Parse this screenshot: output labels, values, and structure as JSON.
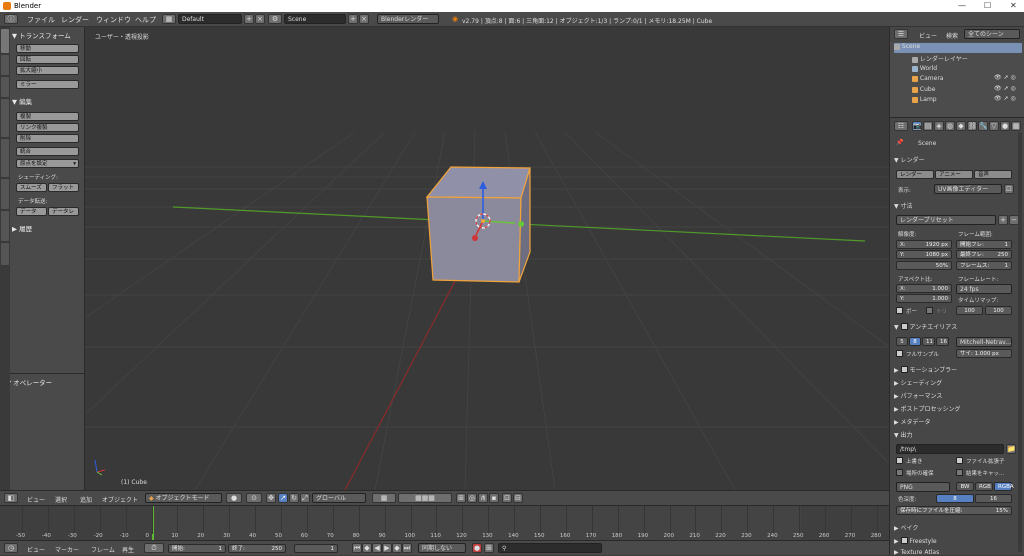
{
  "window": {
    "title": "Blender",
    "minimize": "—",
    "maximize": "☐",
    "close": "✕"
  },
  "menubar": {
    "menus": [
      "ファイル",
      "レンダー",
      "ウィンドウ",
      "ヘルプ"
    ],
    "layout": "Default",
    "scene": "Scene",
    "engine": "Blenderレンダー",
    "stats": "v2.79 | 頂点:8 | 面:6 | 三角面:12 | オブジェクト:1/3 | ランプ:0/1 | メモリ:18.25M | Cube"
  },
  "toolshelf": {
    "transform_header": "トランスフォーム",
    "transform_buttons": [
      "移動",
      "回転",
      "拡大縮小"
    ],
    "mirror": "ミラー",
    "edit_header": "編集",
    "edit_buttons": [
      "複製",
      "リンク複製",
      "削除"
    ],
    "join": "統合",
    "origin": "原点を設定",
    "shading_label": "シェーディング:",
    "smooth": "スムーズ",
    "flat": "フラット",
    "data_transfer_label": "データ転送:",
    "data": "データ",
    "data_layout": "データレ",
    "history": "履歴",
    "operator": "オペレーター"
  },
  "viewport": {
    "view_label": "ユーザー・透視投影",
    "object_label": "(1) Cube"
  },
  "viewport_header": {
    "view": "ビュー",
    "select": "選択",
    "add": "追加",
    "object": "オブジェクト",
    "mode": "オブジェクトモード",
    "orientation": "グローバル"
  },
  "timeline": {
    "ticks": [
      "-50",
      "-40",
      "-30",
      "-20",
      "-10",
      "0",
      "10",
      "20",
      "30",
      "40",
      "50",
      "60",
      "70",
      "80",
      "90",
      "100",
      "110",
      "120",
      "130",
      "140",
      "150",
      "160",
      "170",
      "180",
      "190",
      "200",
      "210",
      "220",
      "230",
      "240",
      "250",
      "260",
      "270",
      "280"
    ],
    "current_frame": 1
  },
  "timeline_header": {
    "view": "ビュー",
    "marker": "マーカー",
    "frame": "フレーム",
    "play": "再生",
    "start_label": "開始:",
    "start": "1",
    "end_label": "終了:",
    "end": "250",
    "current": "1",
    "sync": "同期しない"
  },
  "outliner": {
    "view": "ビュー",
    "search": "検索",
    "filter": "全てのシーン",
    "items": [
      "Scene",
      "レンダーレイヤー",
      "World",
      "Camera",
      "Cube",
      "Lamp"
    ]
  },
  "properties": {
    "scene": "Scene",
    "render_header": "レンダー",
    "render_btn": "レンダー",
    "anim_btn": "アニメー",
    "audio_btn": "音声",
    "display_label": "表示:",
    "display_value": "UV画像エディター",
    "dimensions_header": "寸法",
    "presets": "レンダープリセット",
    "resolution_label": "解像度:",
    "res_x": "X:",
    "res_x_val": "1920 px",
    "res_y": "Y:",
    "res_y_val": "1080 px",
    "res_pct": "50%",
    "frame_range_label": "フレーム範囲:",
    "frame_start": "開始フレ:",
    "frame_start_val": "1",
    "frame_end": "最終フレ:",
    "frame_end_val": "250",
    "frame_step": "フレームス:",
    "frame_step_val": "1",
    "aspect_label": "アスペクト比:",
    "asp_x": "X:",
    "asp_x_val": "1.000",
    "asp_y": "Y:",
    "asp_y_val": "1.000",
    "framerate_label": "フレームレート:",
    "fps": "24 fps",
    "time_remap": "タイムリマップ:",
    "remap_old": "100",
    "remap_new": "100",
    "border": "ボー",
    "crop": "トリ",
    "aa_header": "アンチエイリアス",
    "aa_levels": [
      "5",
      "8",
      "11",
      "16"
    ],
    "aa_filter": "Mitchell-Netrav...",
    "full_sample": "フルサンプル",
    "size_label": "サイ: 1.000 px",
    "sections": [
      "モーションブラー",
      "シェーディング",
      "パフォーマンス",
      "ポストプロセッシング",
      "メタデータ"
    ],
    "output_header": "出力",
    "output_path": "/tmp\\",
    "overwrite": "上書き",
    "file_ext": "ファイル拡張子",
    "placeholders": "場所の確保",
    "cache_result": "結果をキャッ...",
    "format": "PNG",
    "bw": "BW",
    "rgb": "RGB",
    "rgba": "RGBA",
    "color_depth_label": "色深度:",
    "depth_8": "8",
    "depth_16": "16",
    "compression": "保存時にファイルを圧縮:",
    "compression_val": "15%",
    "bake": "ベイク",
    "freestyle": "Freestyle",
    "texture_atlas": "Texture Atlas"
  },
  "colors": {
    "accent": "#5680c2",
    "cube_outline": "#f2a33a",
    "x_axis": "#d03535",
    "y_axis": "#6cc43a",
    "z_axis": "#2c5de0"
  }
}
